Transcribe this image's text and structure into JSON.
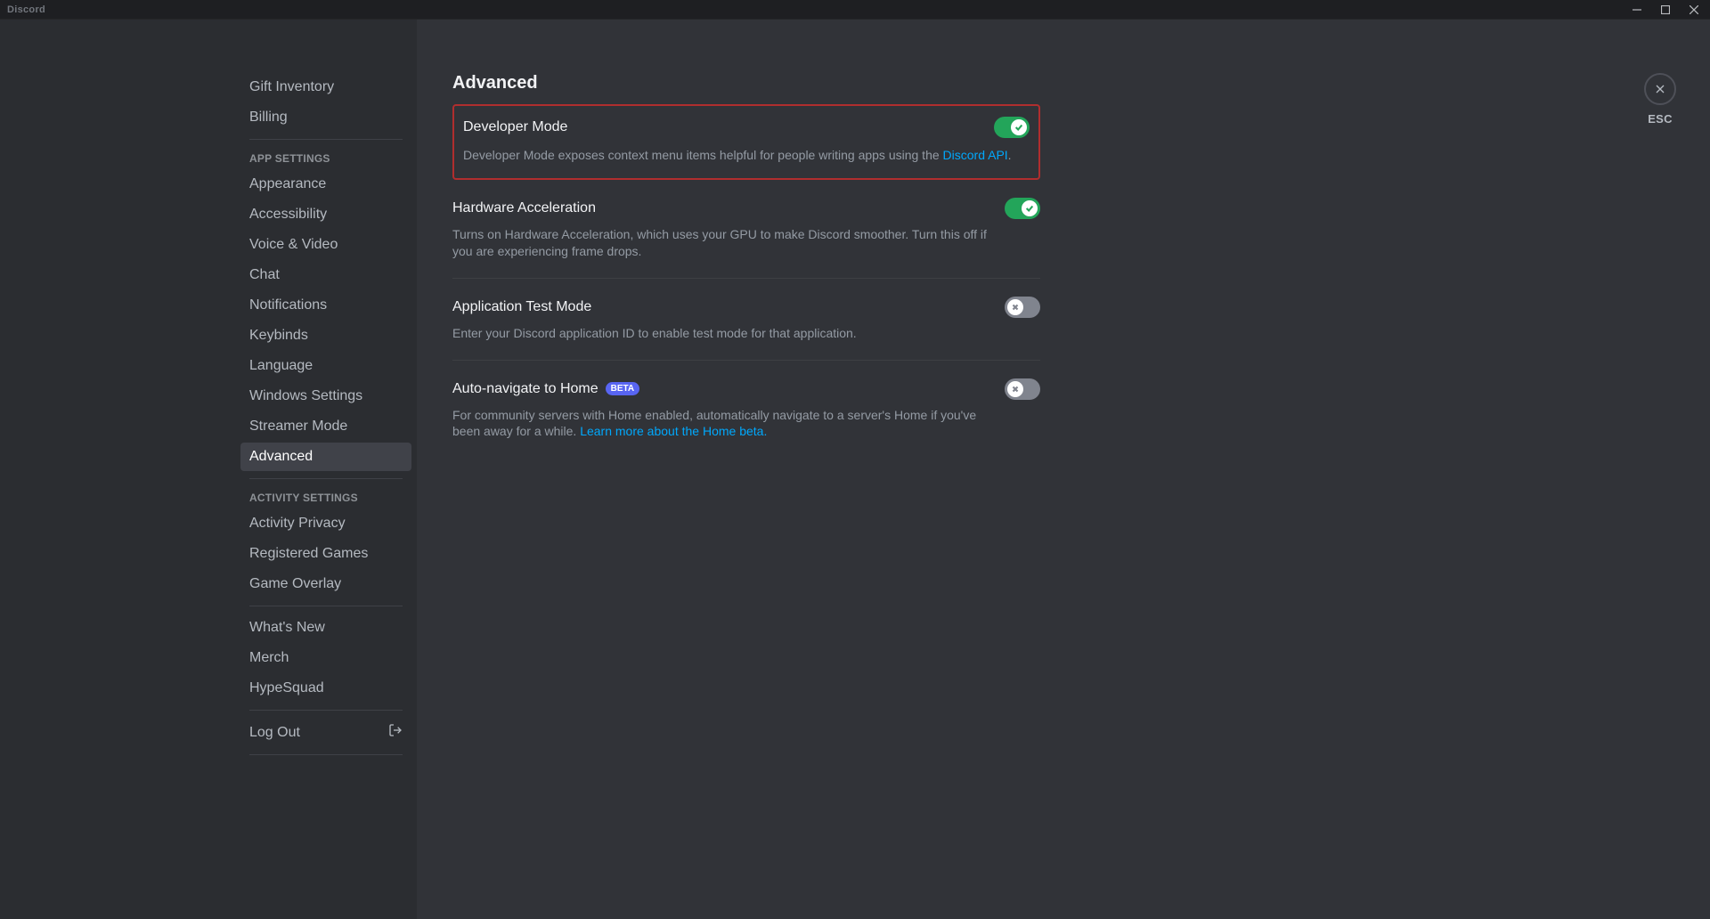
{
  "app_name": "Discord",
  "window": {
    "esc": "ESC"
  },
  "sidebar": {
    "groups": [
      {
        "header": null,
        "items": [
          {
            "label": "Gift Inventory",
            "active": false
          },
          {
            "label": "Billing",
            "active": false
          }
        ]
      },
      {
        "header": "APP SETTINGS",
        "items": [
          {
            "label": "Appearance",
            "active": false
          },
          {
            "label": "Accessibility",
            "active": false
          },
          {
            "label": "Voice & Video",
            "active": false
          },
          {
            "label": "Chat",
            "active": false
          },
          {
            "label": "Notifications",
            "active": false
          },
          {
            "label": "Keybinds",
            "active": false
          },
          {
            "label": "Language",
            "active": false
          },
          {
            "label": "Windows Settings",
            "active": false
          },
          {
            "label": "Streamer Mode",
            "active": false
          },
          {
            "label": "Advanced",
            "active": true
          }
        ]
      },
      {
        "header": "ACTIVITY SETTINGS",
        "items": [
          {
            "label": "Activity Privacy",
            "active": false
          },
          {
            "label": "Registered Games",
            "active": false
          },
          {
            "label": "Game Overlay",
            "active": false
          }
        ]
      },
      {
        "header": null,
        "items": [
          {
            "label": "What's New",
            "active": false
          },
          {
            "label": "Merch",
            "active": false
          },
          {
            "label": "HypeSquad",
            "active": false
          }
        ]
      }
    ],
    "logout": "Log Out"
  },
  "page": {
    "title": "Advanced",
    "settings": {
      "developer_mode": {
        "title": "Developer Mode",
        "desc_pre": "Developer Mode exposes context menu items helpful for people writing apps using the ",
        "link": "Discord API",
        "desc_post": ".",
        "on": true
      },
      "hw_accel": {
        "title": "Hardware Acceleration",
        "desc": "Turns on Hardware Acceleration, which uses your GPU to make Discord smoother. Turn this off if you are experiencing frame drops.",
        "on": true
      },
      "app_test": {
        "title": "Application Test Mode",
        "desc": "Enter your Discord application ID to enable test mode for that application.",
        "on": false
      },
      "auto_home": {
        "title": "Auto-navigate to Home",
        "badge": "BETA",
        "desc_pre": "For community servers with Home enabled, automatically navigate to a server's Home if you've been away for a while. ",
        "link": "Learn more about the Home beta.",
        "on": false
      }
    }
  }
}
